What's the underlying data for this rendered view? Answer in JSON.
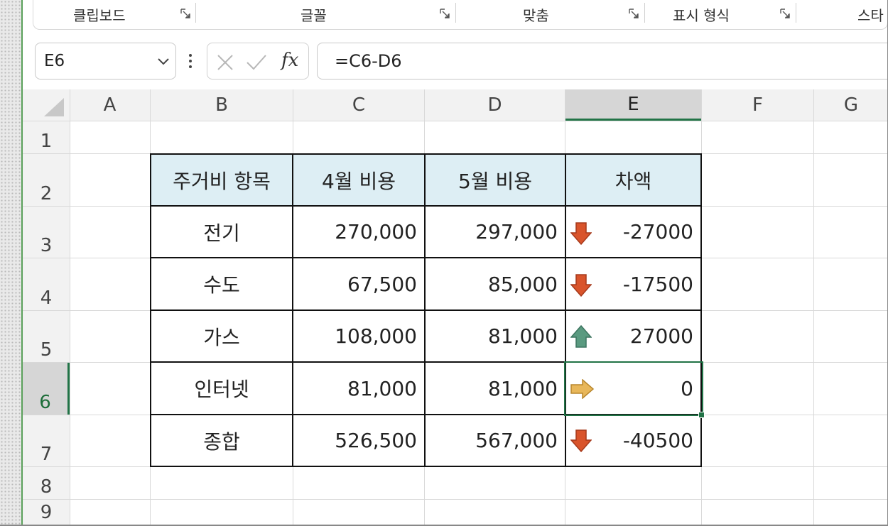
{
  "ribbon": {
    "groups": [
      {
        "label": "클립보드"
      },
      {
        "label": "글꼴"
      },
      {
        "label": "맞춤"
      },
      {
        "label": "표시 형식"
      },
      {
        "label": "스타"
      }
    ]
  },
  "formula_bar": {
    "name_box": "E6",
    "formula": "=C6-D6",
    "fx_symbol": "fx"
  },
  "sheet": {
    "columns": [
      "A",
      "B",
      "C",
      "D",
      "E",
      "F",
      "G"
    ],
    "selected_column": "E",
    "rows": [
      "1",
      "2",
      "3",
      "4",
      "5",
      "6",
      "7",
      "8",
      "9"
    ],
    "selected_row": "6",
    "table": {
      "headers": [
        "주거비 항목",
        "4월 비용",
        "5월 비용",
        "차액"
      ],
      "rows": [
        {
          "item": "전기",
          "april": "270,000",
          "may": "297,000",
          "diff": "-27000",
          "icon": "red-down-arrow-icon"
        },
        {
          "item": "수도",
          "april": "67,500",
          "may": "85,000",
          "diff": "-17500",
          "icon": "red-down-arrow-icon"
        },
        {
          "item": "가스",
          "april": "108,000",
          "may": "81,000",
          "diff": "27000",
          "icon": "green-up-arrow-icon"
        },
        {
          "item": "인터넷",
          "april": "81,000",
          "may": "81,000",
          "diff": "0",
          "icon": "yellow-right-arrow-icon"
        },
        {
          "item": "종합",
          "april": "526,500",
          "may": "567,000",
          "diff": "-40500",
          "icon": "red-down-arrow-icon"
        }
      ]
    },
    "colors": {
      "header_fill": "#ddeef4",
      "selection": "#217346",
      "down_arrow": "#d9542b",
      "up_arrow": "#5a9a80",
      "right_arrow": "#e8b75a"
    }
  }
}
